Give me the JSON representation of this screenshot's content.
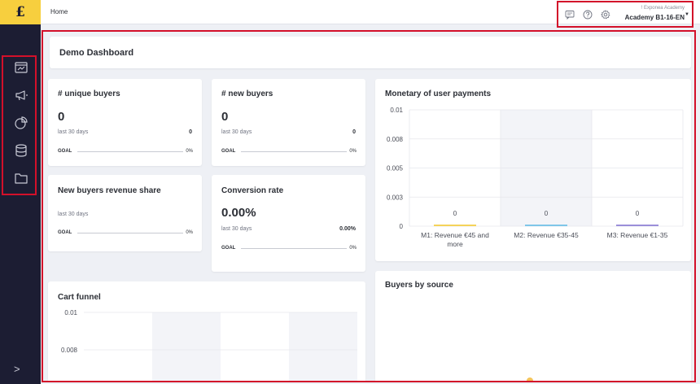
{
  "app": {
    "logo_text": "£"
  },
  "sidebar": {
    "items": [
      {
        "icon": "dashboard-icon"
      },
      {
        "icon": "megaphone-icon"
      },
      {
        "icon": "pie-chart-icon"
      },
      {
        "icon": "database-icon"
      },
      {
        "icon": "folder-icon"
      }
    ],
    "expand_glyph": ">"
  },
  "topbar": {
    "breadcrumb": "Home",
    "icons": [
      "chat-icon",
      "help-icon",
      "settings-icon"
    ],
    "account_org": "! Exponea Academy",
    "account_name": "Academy B1-16-EN"
  },
  "dashboard": {
    "title": "Demo Dashboard",
    "cards": {
      "unique_buyers": {
        "title": "# unique buyers",
        "value": "0",
        "period": "last 30 days",
        "period_value": "0",
        "goal_label": "GOAL",
        "goal_pct": "0%"
      },
      "new_buyers": {
        "title": "# new buyers",
        "value": "0",
        "period": "last 30 days",
        "period_value": "0",
        "goal_label": "GOAL",
        "goal_pct": "0%"
      },
      "revenue_share": {
        "title": "New buyers revenue share",
        "period": "last 30 days",
        "goal_label": "GOAL",
        "goal_pct": "0%"
      },
      "conversion": {
        "title": "Conversion rate",
        "value": "0.00%",
        "period": "last 30 days",
        "period_value": "0.00%",
        "goal_label": "GOAL",
        "goal_pct": "0%"
      },
      "monetary": {
        "title": "Monetary of user payments"
      },
      "cart_funnel": {
        "title": "Cart funnel"
      },
      "buyers_by_source": {
        "title": "Buyers by source"
      }
    }
  },
  "chart_data": [
    {
      "type": "bar",
      "title": "Monetary of user payments",
      "categories": [
        "M1: Revenue €45 and more",
        "M2: Revenue €35-45",
        "M3: Revenue €1-35"
      ],
      "values": [
        0,
        0,
        0
      ],
      "data_labels": [
        "0",
        "0",
        "0"
      ],
      "bar_colors": [
        "#f5d35a",
        "#7fc6e8",
        "#9b8fd9"
      ],
      "yticks": [
        "0.01",
        "0.008",
        "0.005",
        "0.003",
        "0"
      ],
      "ylim": [
        0,
        0.01
      ],
      "grid": true
    },
    {
      "type": "bar",
      "title": "Cart funnel",
      "yticks": [
        "0.01",
        "0.008"
      ],
      "grid": true
    }
  ]
}
